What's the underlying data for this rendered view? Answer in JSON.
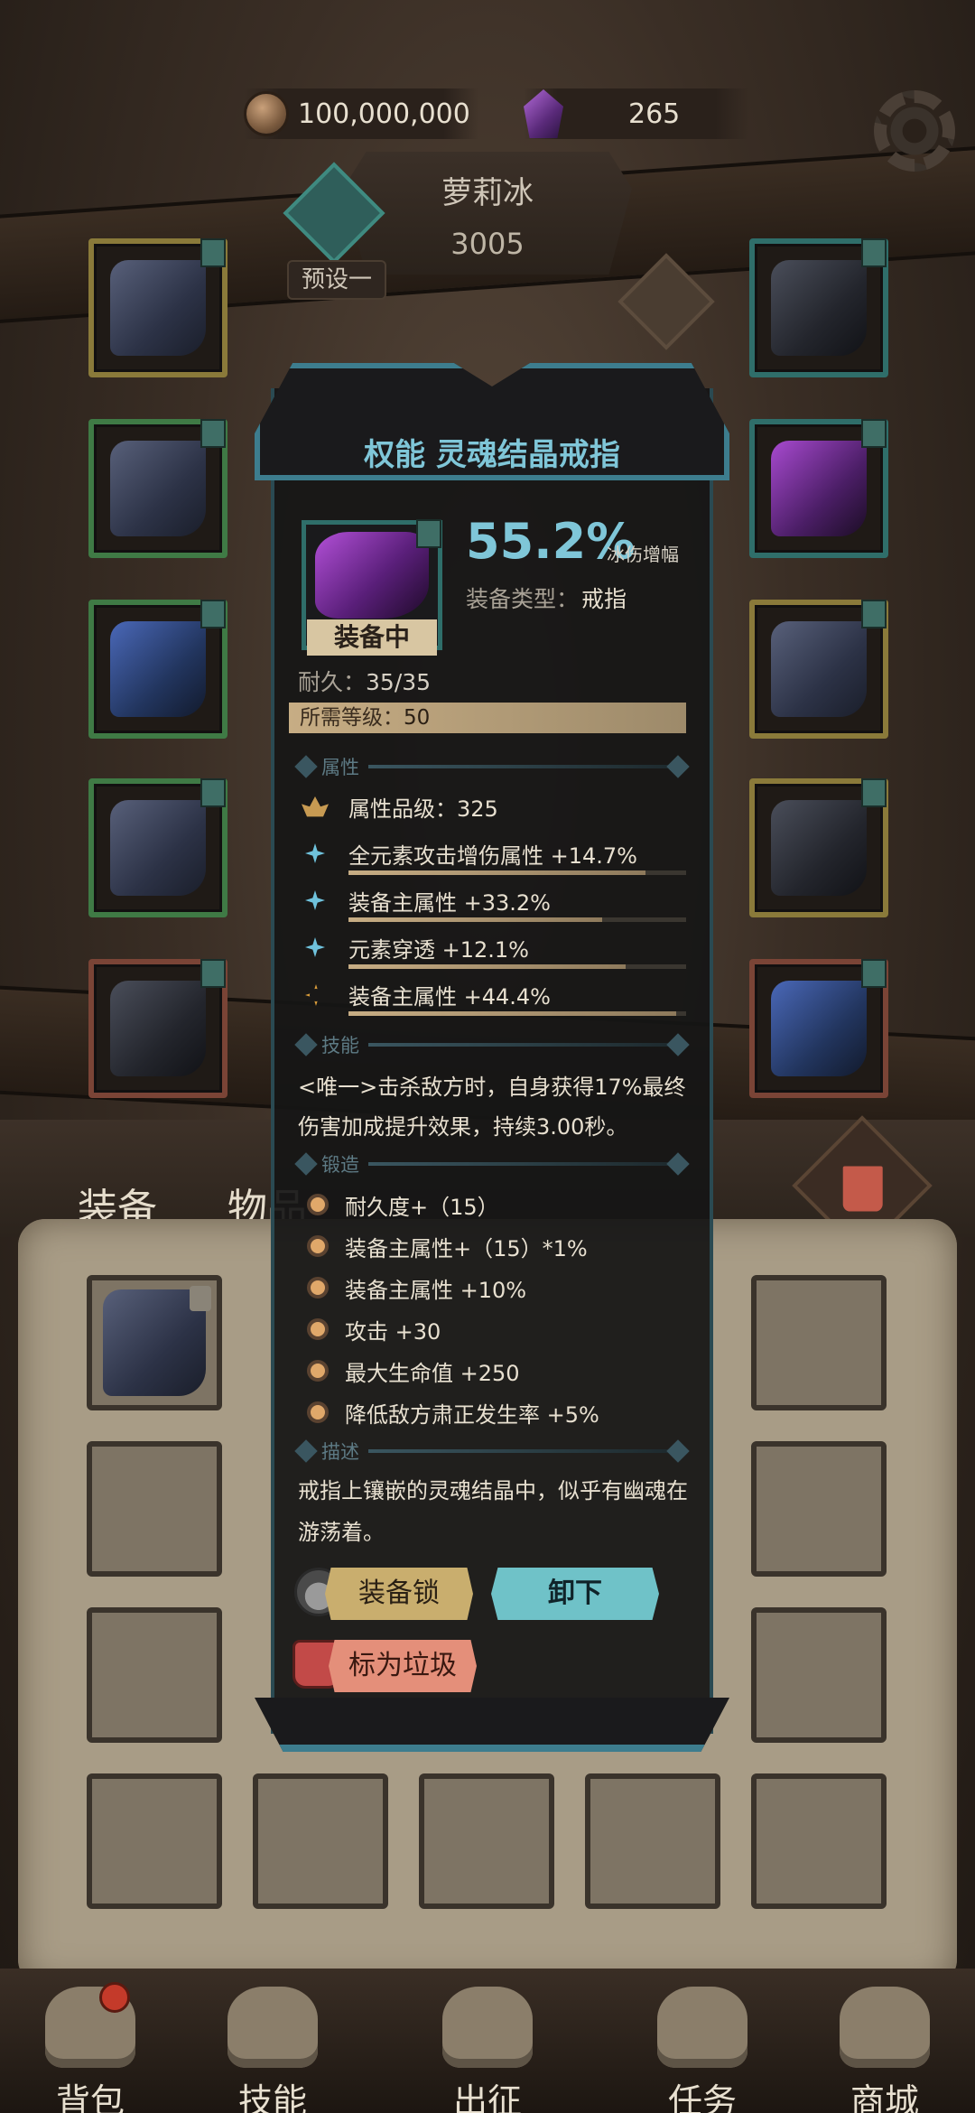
{
  "currency": {
    "gold": "100,000,000",
    "gems": "265"
  },
  "hero": {
    "name": "萝莉冰",
    "power": "3005",
    "preset": "预设一"
  },
  "tabs": {
    "equipment": "装备",
    "items": "物品"
  },
  "item": {
    "title": "权能 灵魂结晶戒指",
    "status": "装备中",
    "main_value": "55.2%",
    "main_label": "冰伤增幅",
    "type_label": "装备类型：",
    "type_value": "戒指",
    "durability_label": "耐久：",
    "durability_value": "35/35",
    "level_label": "所需等级：",
    "level_value": "50",
    "sections": {
      "attributes": "属性",
      "skill": "技能",
      "forge": "锻造",
      "description": "描述"
    },
    "attributes": [
      {
        "text": "属性品级：325",
        "fill": 0.0
      },
      {
        "text": "全元素攻击增伤属性 +14.7%",
        "fill": 0.88
      },
      {
        "text": "装备主属性 +33.2%",
        "fill": 0.75
      },
      {
        "text": "元素穿透 +12.1%",
        "fill": 0.82
      },
      {
        "text": "装备主属性 +44.4%",
        "fill": 0.97
      }
    ],
    "skill_text": "<唯一>击杀敌方时，自身获得17%最终伤害加成提升效果，持续3.00秒。",
    "forge": [
      "耐久度+（15）",
      "装备主属性+（15）*1%",
      "装备主属性 +10%",
      "攻击 +30",
      "最大生命值 +250",
      "降低敌方肃正发生率 +5%"
    ],
    "description": "戒指上镶嵌的灵魂结晶中，似乎有幽魂在游荡着。",
    "buttons": {
      "lock": "装备锁",
      "unequip": "卸下",
      "mark_trash": "标为垃圾"
    }
  },
  "bottom_nav": [
    "背包",
    "技能",
    "出征",
    "任务",
    "商城"
  ],
  "colors": {
    "accent": "#7fc6d8",
    "panel_bg": "#161515",
    "gold_bar": "#c7ad84"
  }
}
